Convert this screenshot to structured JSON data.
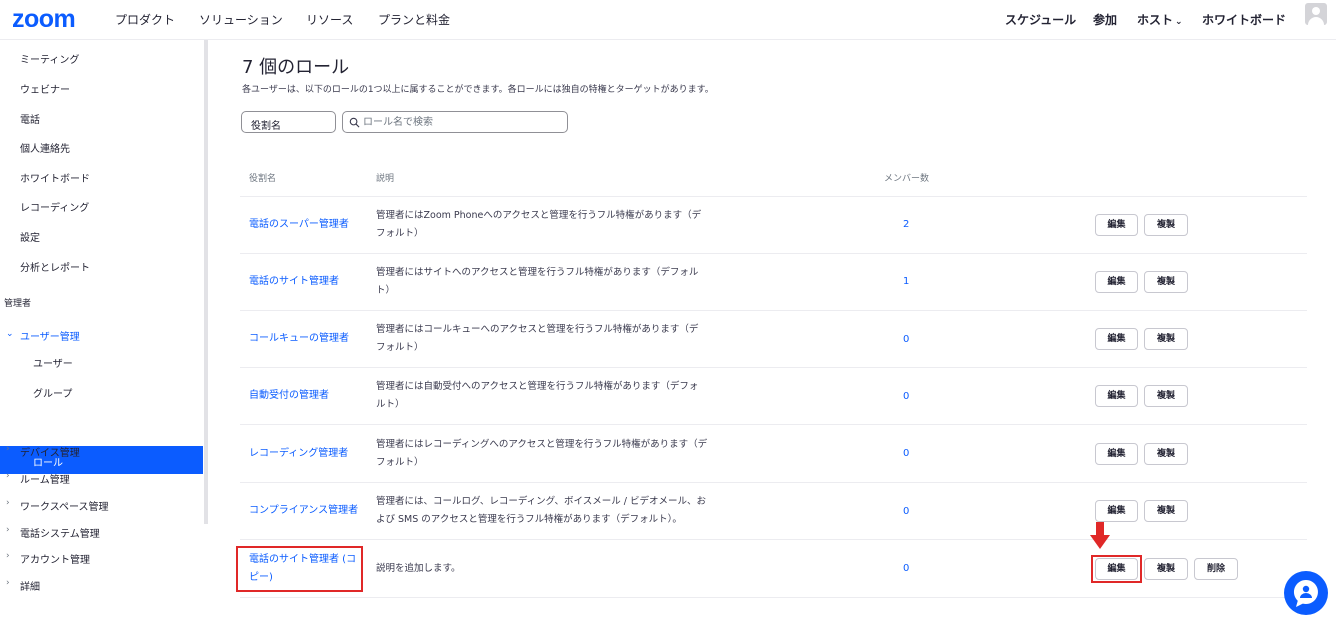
{
  "nav": {
    "logo": "zoom",
    "items": [
      "プロダクト",
      "ソリューション",
      "リソース",
      "プランと料金"
    ],
    "right": {
      "schedule": "スケジュール",
      "join": "参加",
      "host": "ホスト",
      "whiteboard": "ホワイトボード"
    }
  },
  "sidebar": {
    "items": [
      "ミーティング",
      "ウェビナー",
      "電話",
      "個人連絡先",
      "ホワイトボード",
      "レコーディング",
      "設定",
      "分析とレポート"
    ],
    "admin_section": "管理者",
    "user_mgmt": "ユーザー管理",
    "sub_items": [
      "ユーザー",
      "グループ",
      "ロール"
    ],
    "collapsed": [
      "デバイス管理",
      "ルーム管理",
      "ワークスペース管理",
      "電話システム管理",
      "アカウント管理",
      "詳細"
    ]
  },
  "main": {
    "title": "7 個のロール",
    "subtitle": "各ユーザーは、以下のロールの1つ以上に属することができます。各ロールには独自の特権とターゲットがあります。",
    "filter_select": "役割名",
    "search_placeholder": "ロール名で検索",
    "columns": {
      "name": "役割名",
      "description": "説明",
      "members": "メンバー数"
    },
    "buttons": {
      "edit": "編集",
      "duplicate": "複製",
      "delete": "削除"
    },
    "rows": [
      {
        "name": [
          "電話のスーパー管理者"
        ],
        "desc": [
          "管理者にはZoom Phoneへのアクセスと管理を行うフル特権があります（デ",
          "フォルト）"
        ],
        "count": "2"
      },
      {
        "name": [
          "電話のサイト管理者"
        ],
        "desc": [
          "管理者にはサイトへのアクセスと管理を行うフル特権があります（デフォル",
          "ト）"
        ],
        "count": "1"
      },
      {
        "name": [
          "コールキューの管理者"
        ],
        "desc": [
          "管理者にはコールキューへのアクセスと管理を行うフル特権があります（デ",
          "フォルト）"
        ],
        "count": "0"
      },
      {
        "name": [
          "自動受付の管理者"
        ],
        "desc": [
          "管理者には自動受付へのアクセスと管理を行うフル特権があります（デフォ",
          "ルト）"
        ],
        "count": "0"
      },
      {
        "name": [
          "レコーディング管理者"
        ],
        "desc": [
          "管理者にはレコーディングへのアクセスと管理を行うフル特権があります（デ",
          "フォルト）"
        ],
        "count": "0"
      },
      {
        "name": [
          "コンプライアンス管理者"
        ],
        "desc": [
          "管理者には、コールログ、レコーディング、ボイスメール / ビデオメール、お",
          "よび SMS のアクセスと管理を行うフル特権があります（デフォルト）。"
        ],
        "count": "0"
      },
      {
        "name": [
          "電話のサイト管理者 (コ",
          "ピー)"
        ],
        "desc": [
          "説明を追加します。"
        ],
        "count": "0"
      }
    ]
  },
  "colors": {
    "accent": "#0b5cff",
    "highlight": "#e02828",
    "text": "#232333"
  }
}
